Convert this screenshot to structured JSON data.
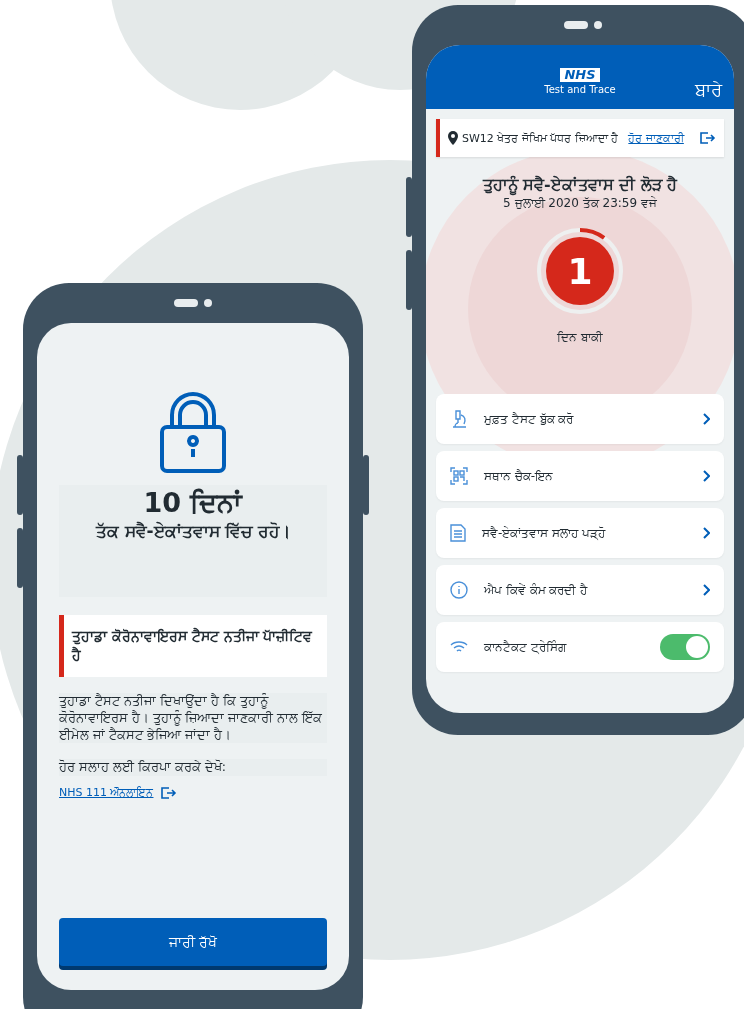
{
  "left_phone": {
    "lock_title": "10 ਦਿਨਾਂ",
    "lock_subtitle": "ਤੱਕ ਸਵੈ-ਏਕਾਂਤਵਾਸ ਵਿੱਚ ਰਹੋ।",
    "result_banner": "ਤੁਹਾਡਾ ਕੋਰੋਨਾਵਾਇਰਸ ਟੈਸਟ ਨਤੀਜਾ ਪਾੱਜ਼ੀਟਿਵ ਹੈ",
    "body": "ਤੁਹਾਡਾ ਟੈਸਟ ਨਤੀਜਾ ਦਿਖਾਉਂਦਾ ਹੈ ਕਿ ਤੁਹਾਨੂੰ ਕੋਰੋਨਾਵਾਇਰਸ ਹੈ। ਤੁਹਾਨੂੰ ਜ਼ਿਆਦਾ ਜਾਣਕਾਰੀ ਨਾਲ ਇੱਕ ਈਮੇਲ ਜਾਂ ਟੈਕਸਟ ਭੇਜਿਆ ਜਾਂਦਾ ਹੈ।",
    "advice_label": "ਹੋਰ ਸਲਾਹ ਲਈ ਕਿਰਪਾ ਕਰਕੇ ਦੇਖੋ:",
    "link": "NHS 111 ਔਨਲਾਇਨ",
    "button": "ਜਾਰੀ ਰੱਖੋ"
  },
  "right_phone": {
    "header": {
      "logo": "NHS",
      "logo_subtitle": "Test and Trace",
      "about": "ਬਾਰੇ"
    },
    "risk_banner": {
      "text": "SW12 ਖੇਤਰ ਜੋਖਿਮ ਪੱਧਰ ਜ਼ਿਆਦਾ ਹੈ",
      "link": "ਹੋਰ ਜਾਣਕਾਰੀ"
    },
    "title": "ਤੁਹਾਨੂੰ ਸਵੈ-ਏਕਾਂਤਵਾਸ ਦੀ ਲੋੜ ਹੈ",
    "deadline": "5 ਜੁਲਾਈ 2020 ਤੱਕ 23:59 ਵਜੇ",
    "countdown": {
      "number": "1",
      "level": 0.1,
      "label": "ਦਿਨ ਬਾਕੀ"
    },
    "menu": [
      {
        "kind": "link",
        "label": "ਮੁਫ਼ਤ ਟੈਸਟ ਬੁੱਕ ਕਰੋ"
      },
      {
        "kind": "link",
        "label": "ਸਥਾਨ ਚੈਕ-ਇਨ"
      },
      {
        "kind": "link",
        "label": "ਸਵੈ-ਏਕਾਂਤਵਾਸ ਸਲਾਹ ਪੜ੍ਹੋ"
      },
      {
        "kind": "link",
        "label": "ਐਪ ਕਿਵੇਂ ਕੰਮ ਕਰਦੀ ਹੈ"
      },
      {
        "kind": "toggle",
        "label": "ਕਾਨਟੈਕਟ ਟ੍ਰੇਸਿੰਗ",
        "on": true
      }
    ]
  }
}
